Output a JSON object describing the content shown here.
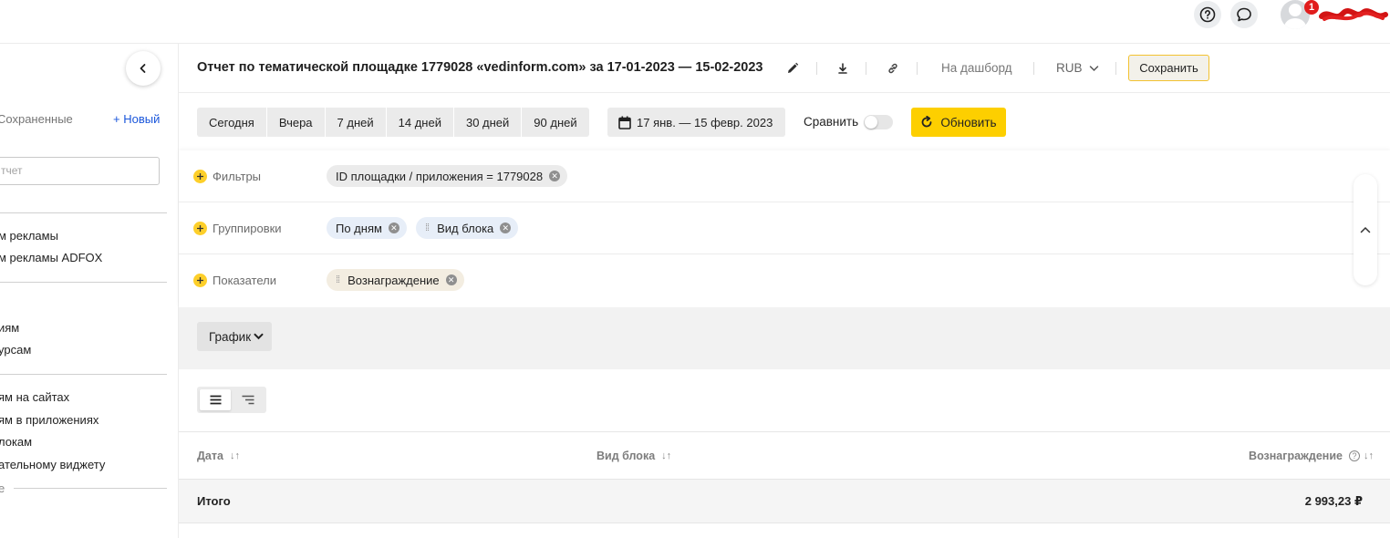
{
  "header": {
    "help_icon": "question-circle-icon",
    "chat_icon": "chat-bubble-icon",
    "notification_count": "1"
  },
  "sidebar": {
    "saved_label": "Сохраненные",
    "new_label": "+ Новый",
    "search_placeholder": "тчет",
    "items": [
      "м рекламы",
      "м рекламы ADFOX",
      "иям",
      "урсам",
      "ям на сайтах",
      "ям в приложениях",
      "локам",
      "ательному виджету"
    ],
    "more_label": "е"
  },
  "report": {
    "title": "Отчет по тематической площадке 1779028 «vedinform.com» за 17-01-2023 — 15-02-2023",
    "dashboard_label": "На дашборд",
    "currency": "RUB",
    "save_label": "Сохранить"
  },
  "period": {
    "buttons": [
      "Сегодня",
      "Вчера",
      "7 дней",
      "14 дней",
      "30 дней",
      "90 дней"
    ],
    "date_range": "17 янв. — 15 февр. 2023",
    "compare_label": "Сравнить",
    "compare_enabled": false,
    "refresh_label": "Обновить"
  },
  "config": {
    "filters_label": "Фильтры",
    "filter_chip": "ID площадки / приложения = 1779028",
    "groupings_label": "Группировки",
    "grouping_chips": [
      "По дням",
      "Вид блока"
    ],
    "metrics_label": "Показатели",
    "metric_chips": [
      "Вознаграждение"
    ]
  },
  "chart_toggle_label": "График",
  "table": {
    "columns": [
      "Дата",
      "Вид блока",
      "Вознаграждение"
    ],
    "total_label": "Итого",
    "total_value": "2 993,23 ₽"
  },
  "colors": {
    "accent_yellow": "#fdcf00",
    "link_blue": "#1a56db",
    "notification_red": "#e11d1d"
  }
}
